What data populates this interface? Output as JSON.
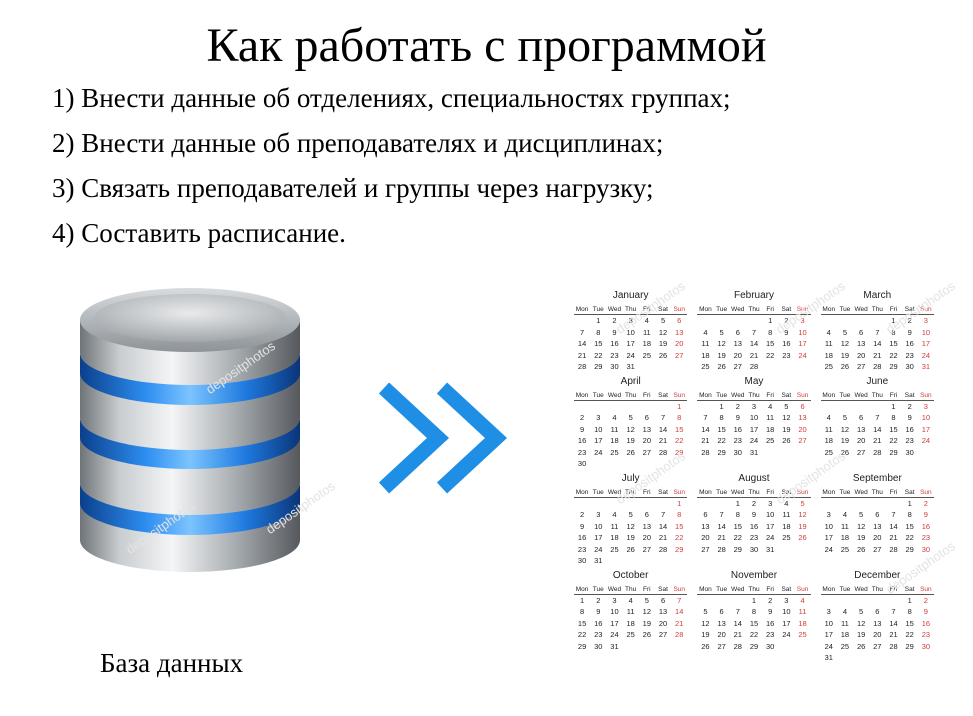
{
  "title": "Как работать с программой",
  "steps": [
    "1) Внести данные об отделениях, специальностях группах;",
    "2) Внести данные об преподавателях и дисциплинах;",
    "3) Связать преподавателей и группы через нагрузку;",
    "4) Составить расписание."
  ],
  "database": {
    "icon": "database-icon",
    "caption": "База данных"
  },
  "arrow": {
    "icon": "double-chevron-right-icon",
    "color": "#1f8fe6"
  },
  "watermark": "depositphotos",
  "calendar": {
    "icon": "calendar-icon",
    "weekdays": [
      "Mon",
      "Tue",
      "Wed",
      "Thu",
      "Fri",
      "Sat",
      "Sun"
    ],
    "sunday_color": "#d23b3b",
    "months": [
      {
        "name": "January",
        "weeks": [
          [
            "",
            "1",
            "2",
            "3",
            "4",
            "5",
            "6"
          ],
          [
            "7",
            "8",
            "9",
            "10",
            "11",
            "12",
            "13"
          ],
          [
            "14",
            "15",
            "16",
            "17",
            "18",
            "19",
            "20"
          ],
          [
            "21",
            "22",
            "23",
            "24",
            "25",
            "26",
            "27"
          ],
          [
            "28",
            "29",
            "30",
            "31",
            "",
            "",
            ""
          ]
        ]
      },
      {
        "name": "February",
        "weeks": [
          [
            "",
            "",
            "",
            "",
            "1",
            "2",
            "3"
          ],
          [
            "4",
            "5",
            "6",
            "7",
            "8",
            "9",
            "10"
          ],
          [
            "11",
            "12",
            "13",
            "14",
            "15",
            "16",
            "17"
          ],
          [
            "18",
            "19",
            "20",
            "21",
            "22",
            "23",
            "24"
          ],
          [
            "25",
            "26",
            "27",
            "28",
            "",
            "",
            ""
          ]
        ]
      },
      {
        "name": "March",
        "weeks": [
          [
            "",
            "",
            "",
            "",
            "1",
            "2",
            "3"
          ],
          [
            "4",
            "5",
            "6",
            "7",
            "8",
            "9",
            "10"
          ],
          [
            "11",
            "12",
            "13",
            "14",
            "15",
            "16",
            "17"
          ],
          [
            "18",
            "19",
            "20",
            "21",
            "22",
            "23",
            "24"
          ],
          [
            "25",
            "26",
            "27",
            "28",
            "29",
            "30",
            "31"
          ]
        ]
      },
      {
        "name": "April",
        "weeks": [
          [
            "",
            "",
            "",
            "",
            "",
            "",
            "1"
          ],
          [
            "2",
            "3",
            "4",
            "5",
            "6",
            "7",
            "8"
          ],
          [
            "9",
            "10",
            "11",
            "12",
            "13",
            "14",
            "15"
          ],
          [
            "16",
            "17",
            "18",
            "19",
            "20",
            "21",
            "22"
          ],
          [
            "23",
            "24",
            "25",
            "26",
            "27",
            "28",
            "29"
          ],
          [
            "30",
            "",
            "",
            "",
            "",
            "",
            ""
          ]
        ]
      },
      {
        "name": "May",
        "weeks": [
          [
            "",
            "1",
            "2",
            "3",
            "4",
            "5",
            "6"
          ],
          [
            "7",
            "8",
            "9",
            "10",
            "11",
            "12",
            "13"
          ],
          [
            "14",
            "15",
            "16",
            "17",
            "18",
            "19",
            "20"
          ],
          [
            "21",
            "22",
            "23",
            "24",
            "25",
            "26",
            "27"
          ],
          [
            "28",
            "29",
            "30",
            "31",
            "",
            "",
            ""
          ]
        ]
      },
      {
        "name": "June",
        "weeks": [
          [
            "",
            "",
            "",
            "",
            "1",
            "2",
            "3"
          ],
          [
            "4",
            "5",
            "6",
            "7",
            "8",
            "9",
            "10"
          ],
          [
            "11",
            "12",
            "13",
            "14",
            "15",
            "16",
            "17"
          ],
          [
            "18",
            "19",
            "20",
            "21",
            "22",
            "23",
            "24"
          ],
          [
            "25",
            "26",
            "27",
            "28",
            "29",
            "30",
            ""
          ]
        ]
      },
      {
        "name": "July",
        "weeks": [
          [
            "",
            "",
            "",
            "",
            "",
            "",
            "1"
          ],
          [
            "2",
            "3",
            "4",
            "5",
            "6",
            "7",
            "8"
          ],
          [
            "9",
            "10",
            "11",
            "12",
            "13",
            "14",
            "15"
          ],
          [
            "16",
            "17",
            "18",
            "19",
            "20",
            "21",
            "22"
          ],
          [
            "23",
            "24",
            "25",
            "26",
            "27",
            "28",
            "29"
          ],
          [
            "30",
            "31",
            "",
            "",
            "",
            "",
            ""
          ]
        ]
      },
      {
        "name": "August",
        "weeks": [
          [
            "",
            "",
            "1",
            "2",
            "3",
            "4",
            "5"
          ],
          [
            "6",
            "7",
            "8",
            "9",
            "10",
            "11",
            "12"
          ],
          [
            "13",
            "14",
            "15",
            "16",
            "17",
            "18",
            "19"
          ],
          [
            "20",
            "21",
            "22",
            "23",
            "24",
            "25",
            "26"
          ],
          [
            "27",
            "28",
            "29",
            "30",
            "31",
            "",
            ""
          ]
        ]
      },
      {
        "name": "September",
        "weeks": [
          [
            "",
            "",
            "",
            "",
            "",
            "1",
            "2"
          ],
          [
            "3",
            "4",
            "5",
            "6",
            "7",
            "8",
            "9"
          ],
          [
            "10",
            "11",
            "12",
            "13",
            "14",
            "15",
            "16"
          ],
          [
            "17",
            "18",
            "19",
            "20",
            "21",
            "22",
            "23"
          ],
          [
            "24",
            "25",
            "26",
            "27",
            "28",
            "29",
            "30"
          ]
        ]
      },
      {
        "name": "October",
        "weeks": [
          [
            "1",
            "2",
            "3",
            "4",
            "5",
            "6",
            "7"
          ],
          [
            "8",
            "9",
            "10",
            "11",
            "12",
            "13",
            "14"
          ],
          [
            "15",
            "16",
            "17",
            "18",
            "19",
            "20",
            "21"
          ],
          [
            "22",
            "23",
            "24",
            "25",
            "26",
            "27",
            "28"
          ],
          [
            "29",
            "30",
            "31",
            "",
            "",
            "",
            ""
          ]
        ]
      },
      {
        "name": "November",
        "weeks": [
          [
            "",
            "",
            "",
            "1",
            "2",
            "3",
            "4"
          ],
          [
            "5",
            "6",
            "7",
            "8",
            "9",
            "10",
            "11"
          ],
          [
            "12",
            "13",
            "14",
            "15",
            "16",
            "17",
            "18"
          ],
          [
            "19",
            "20",
            "21",
            "22",
            "23",
            "24",
            "25"
          ],
          [
            "26",
            "27",
            "28",
            "29",
            "30",
            "",
            ""
          ]
        ]
      },
      {
        "name": "December",
        "weeks": [
          [
            "",
            "",
            "",
            "",
            "",
            "1",
            "2"
          ],
          [
            "3",
            "4",
            "5",
            "6",
            "7",
            "8",
            "9"
          ],
          [
            "10",
            "11",
            "12",
            "13",
            "14",
            "15",
            "16"
          ],
          [
            "17",
            "18",
            "19",
            "20",
            "21",
            "22",
            "23"
          ],
          [
            "24",
            "25",
            "26",
            "27",
            "28",
            "29",
            "30"
          ],
          [
            "31",
            "",
            "",
            "",
            "",
            "",
            ""
          ]
        ]
      }
    ]
  }
}
